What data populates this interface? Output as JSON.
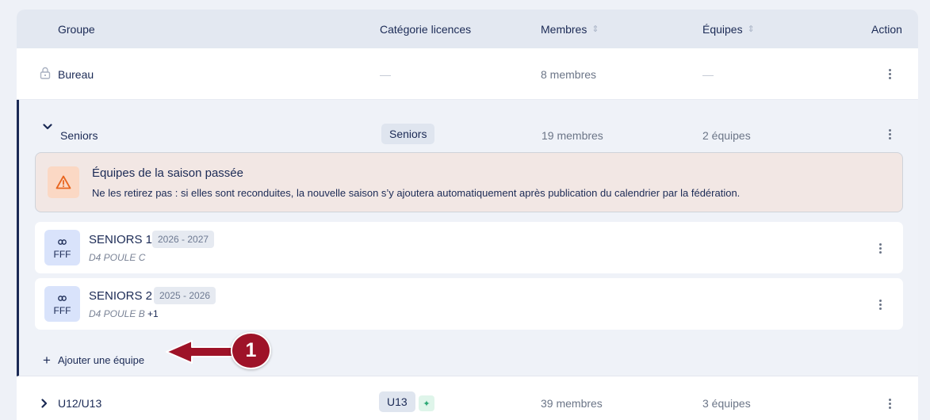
{
  "table": {
    "headers": {
      "group": "Groupe",
      "license_category": "Catégorie licences",
      "members": "Membres",
      "teams": "Équipes",
      "action": "Action"
    }
  },
  "rows": {
    "bureau": {
      "name": "Bureau",
      "category": "—",
      "members": "8 membres",
      "teams": "—"
    },
    "seniors": {
      "name": "Seniors",
      "category": "Seniors",
      "members": "19 membres",
      "teams": "2 équipes",
      "alert": {
        "title": "Équipes de la saison passée",
        "text": "Ne les retirez pas : si elles sont reconduites, la nouvelle saison s’y ajoutera automatiquement après publication du calendrier par la fédération."
      },
      "team_items": [
        {
          "badge": "FFF",
          "name": "SENIORS 1",
          "season": "2026 - 2027",
          "division": "D4 POULE C",
          "extra": ""
        },
        {
          "badge": "FFF",
          "name": "SENIORS 2",
          "season": "2025 - 2026",
          "division": "D4 POULE B",
          "extra": "+1"
        }
      ],
      "add_team_label": "Ajouter une équipe"
    },
    "u12": {
      "name": "U12/U13",
      "category": "U13",
      "members": "39 membres",
      "teams": "3 équipes"
    }
  },
  "callout": {
    "number": "1",
    "color": "#9e1328"
  },
  "colors": {
    "navy": "#1b2a55",
    "header_bg": "#e3e8f1",
    "expanded_bg": "#eff2f8",
    "alert_bg": "#f2e7e4",
    "warning_orange": "#e8651e",
    "fff_badge_bg": "#d9e3fb"
  },
  "icons": {
    "lock": "lock-icon",
    "warning": "warning-triangle-icon",
    "link": "link-icon",
    "sparkle": "sparkle-icon"
  }
}
